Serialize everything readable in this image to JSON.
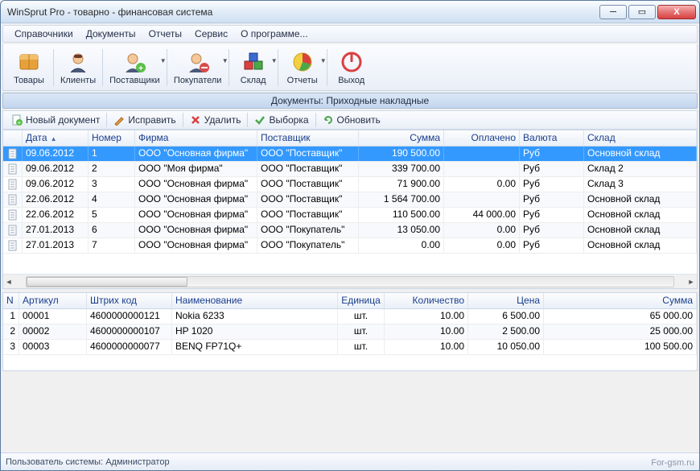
{
  "window": {
    "title": "WinSprut Pro - товарно - финансовая система"
  },
  "menu": [
    "Справочники",
    "Документы",
    "Отчеты",
    "Сервис",
    "О программе..."
  ],
  "toolbar": [
    {
      "label": "Товары"
    },
    {
      "label": "Клиенты"
    },
    {
      "label": "Поставщики"
    },
    {
      "label": "Покупатели"
    },
    {
      "label": "Склад"
    },
    {
      "label": "Отчеты"
    },
    {
      "label": "Выход"
    }
  ],
  "section": {
    "title": "Документы: Приходные накладные"
  },
  "doc_toolbar": {
    "new": "Новый документ",
    "edit": "Исправить",
    "delete": "Удалить",
    "filter": "Выборка",
    "refresh": "Обновить"
  },
  "grid": {
    "columns": [
      "Дата",
      "Номер",
      "Фирма",
      "Поставщик",
      "Сумма",
      "Оплачено",
      "Валюта",
      "Склад"
    ],
    "rows": [
      {
        "date": "09.06.2012",
        "num": "1",
        "firm": "ООО \"Основная фирма\"",
        "supplier": "ООО \"Поставщик\"",
        "sum": "190 500.00",
        "paid": "",
        "currency": "Руб",
        "warehouse": "Основной склад"
      },
      {
        "date": "09.06.2012",
        "num": "2",
        "firm": "ООО \"Моя фирма\"",
        "supplier": "ООО \"Поставщик\"",
        "sum": "339 700.00",
        "paid": "",
        "currency": "Руб",
        "warehouse": "Склад 2"
      },
      {
        "date": "09.06.2012",
        "num": "3",
        "firm": "ООО \"Основная фирма\"",
        "supplier": "ООО \"Поставщик\"",
        "sum": "71 900.00",
        "paid": "0.00",
        "currency": "Руб",
        "warehouse": "Склад 3"
      },
      {
        "date": "22.06.2012",
        "num": "4",
        "firm": "ООО \"Основная фирма\"",
        "supplier": "ООО \"Поставщик\"",
        "sum": "1 564 700.00",
        "paid": "",
        "currency": "Руб",
        "warehouse": "Основной склад"
      },
      {
        "date": "22.06.2012",
        "num": "5",
        "firm": "ООО \"Основная фирма\"",
        "supplier": "ООО \"Поставщик\"",
        "sum": "110 500.00",
        "paid": "44 000.00",
        "currency": "Руб",
        "warehouse": "Основной склад"
      },
      {
        "date": "27.01.2013",
        "num": "6",
        "firm": "ООО \"Основная фирма\"",
        "supplier": "ООО \"Покупатель\"",
        "sum": "13 050.00",
        "paid": "0.00",
        "currency": "Руб",
        "warehouse": "Основной склад"
      },
      {
        "date": "27.01.2013",
        "num": "7",
        "firm": "ООО \"Основная фирма\"",
        "supplier": "ООО \"Покупатель\"",
        "sum": "0.00",
        "paid": "0.00",
        "currency": "Руб",
        "warehouse": "Основной склад"
      }
    ]
  },
  "detail": {
    "columns": [
      "N",
      "Артикул",
      "Штрих код",
      "Наименование",
      "Единица",
      "Количество",
      "Цена",
      "Сумма"
    ],
    "rows": [
      {
        "n": "1",
        "art": "00001",
        "bar": "4600000000121",
        "name": "Nokia 6233",
        "unit": "шт.",
        "qty": "10.00",
        "price": "6 500.00",
        "sum": "65 000.00"
      },
      {
        "n": "2",
        "art": "00002",
        "bar": "4600000000107",
        "name": "HP 1020",
        "unit": "шт.",
        "qty": "10.00",
        "price": "2 500.00",
        "sum": "25 000.00"
      },
      {
        "n": "3",
        "art": "00003",
        "bar": "4600000000077",
        "name": "BENQ FP71Q+",
        "unit": "шт.",
        "qty": "10.00",
        "price": "10 050.00",
        "sum": "100 500.00"
      }
    ]
  },
  "status": {
    "user_label": "Пользователь системы:",
    "user": "Администратор",
    "watermark": "For-gsm.ru"
  }
}
